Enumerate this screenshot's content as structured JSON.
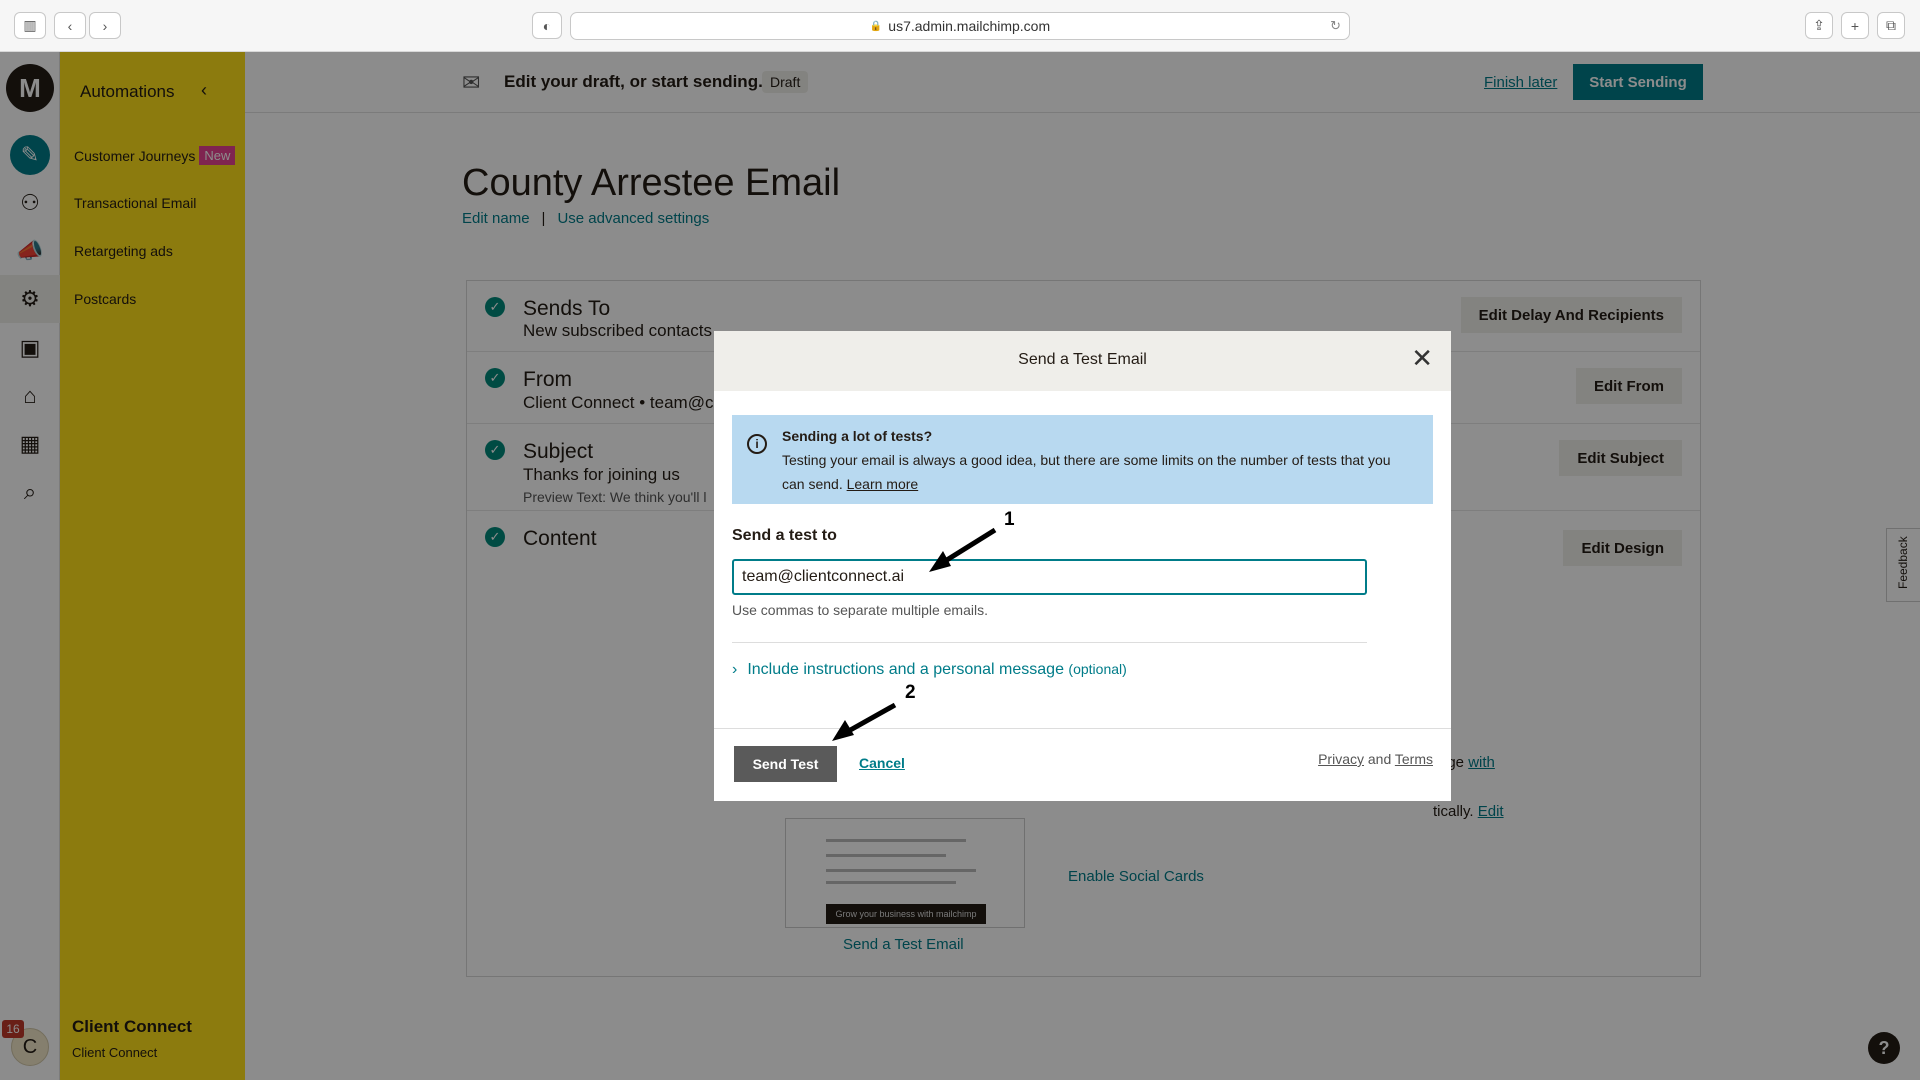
{
  "browser": {
    "url": "us7.admin.mailchimp.com"
  },
  "sidebar": {
    "title": "Automations",
    "items": [
      {
        "label": "Customer Journeys",
        "badge": "New"
      },
      {
        "label": "Transactional Email"
      },
      {
        "label": "Retargeting ads"
      },
      {
        "label": "Postcards"
      }
    ],
    "account": {
      "name": "Client Connect",
      "sub": "Client Connect",
      "avatar_letter": "C",
      "notification_count": "16"
    }
  },
  "topbar": {
    "message": "Edit your draft, or start sending.",
    "status": "Draft",
    "finish_later": "Finish later",
    "start_sending": "Start Sending"
  },
  "page": {
    "title": "County Arrestee Email",
    "edit_name": "Edit name",
    "advanced_settings": "Use advanced settings"
  },
  "checklist": [
    {
      "title": "Sends To",
      "sub": "New subscribed contacts",
      "button": "Edit Delay And Recipients"
    },
    {
      "title": "From",
      "sub": "Client Connect • team@cl",
      "button": "Edit From"
    },
    {
      "title": "Subject",
      "sub": "Thanks for joining us",
      "note": "Preview Text: We think you'll l",
      "button": "Edit Subject"
    },
    {
      "title": "Content",
      "button": "Edit Design"
    }
  ],
  "content_panel": {
    "badge_text": "dge",
    "badge_link": "with",
    "auto_text": "tically.",
    "auto_link": "Edit",
    "social_cards": "Enable Social Cards",
    "preview_link": "Send a Test Email",
    "preview_bar": "Grow your business with mailchimp"
  },
  "modal": {
    "title": "Send a Test Email",
    "info_title": "Sending a lot of tests?",
    "info_body": "Testing your email is always a good idea, but there are some limits on the number of tests that you can send.",
    "info_link": "Learn more",
    "field_label": "Send a test to",
    "email_value": "team@clientconnect.ai",
    "hint": "Use commas to separate multiple emails.",
    "expander_label": "Include instructions and a personal message",
    "expander_optional": "(optional)",
    "send_button": "Send Test",
    "cancel": "Cancel",
    "privacy": "Privacy",
    "and": "and",
    "terms": "Terms"
  },
  "annotations": {
    "first": "1",
    "second": "2"
  },
  "feedback": "Feedback",
  "help": "?",
  "colors": {
    "brand_yellow": "#ffe01b",
    "accent_teal": "#007c89",
    "info_blue": "#b8d9f0"
  }
}
